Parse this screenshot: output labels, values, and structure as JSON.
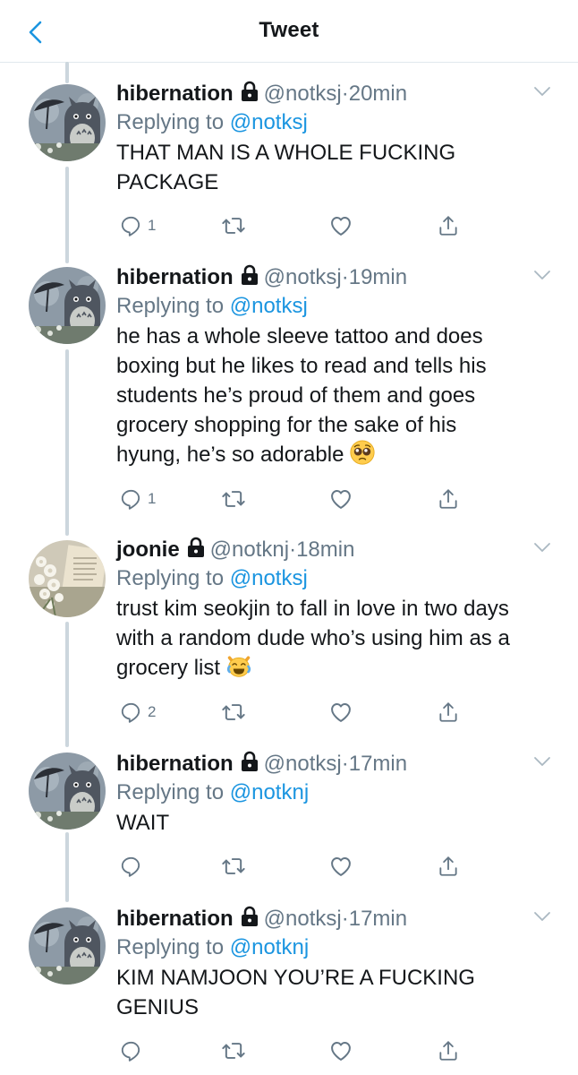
{
  "header": {
    "title": "Tweet"
  },
  "tweets": [
    {
      "name": "hibernation",
      "handle": "@notksj",
      "sep": "·",
      "time": "20min",
      "reply_prefix": "Replying to ",
      "reply_to": "@notksj",
      "text": "THAT MAN IS A WHOLE FUCKING PACKAGE",
      "emoji": "",
      "replies": "1",
      "avatar": "totoro-avatar"
    },
    {
      "name": "hibernation",
      "handle": "@notksj",
      "sep": "·",
      "time": "19min",
      "reply_prefix": "Replying to ",
      "reply_to": "@notksj",
      "text": "he has a whole sleeve tattoo and does boxing but he likes to read and tells his students he’s proud of them and goes grocery shopping for the sake of his hyung, he’s so adorable",
      "emoji": "pleading-face-emoji",
      "replies": "1",
      "avatar": "totoro-avatar"
    },
    {
      "name": "joonie",
      "handle": "@notknj",
      "sep": "·",
      "time": "18min",
      "reply_prefix": "Replying to ",
      "reply_to": "@notksj",
      "text": "trust kim seokjin to fall in love in two days with a random dude who’s using him as a grocery list",
      "emoji": "crying-laughing-cat-emoji",
      "replies": "2",
      "avatar": "flowers-book-avatar"
    },
    {
      "name": "hibernation",
      "handle": "@notksj",
      "sep": "·",
      "time": "17min",
      "reply_prefix": "Replying to ",
      "reply_to": "@notknj",
      "text": "WAIT",
      "emoji": "",
      "replies": "",
      "avatar": "totoro-avatar"
    },
    {
      "name": "hibernation",
      "handle": "@notksj",
      "sep": "·",
      "time": "17min",
      "reply_prefix": "Replying to ",
      "reply_to": "@notknj",
      "text": "KIM NAMJOON YOU’RE A FUCKING GENIUS",
      "emoji": "",
      "replies": "",
      "avatar": "totoro-avatar"
    }
  ],
  "colors": {
    "accent": "#1b95e0",
    "secondary_text": "#657786",
    "thread_line": "#ccd6dd"
  }
}
